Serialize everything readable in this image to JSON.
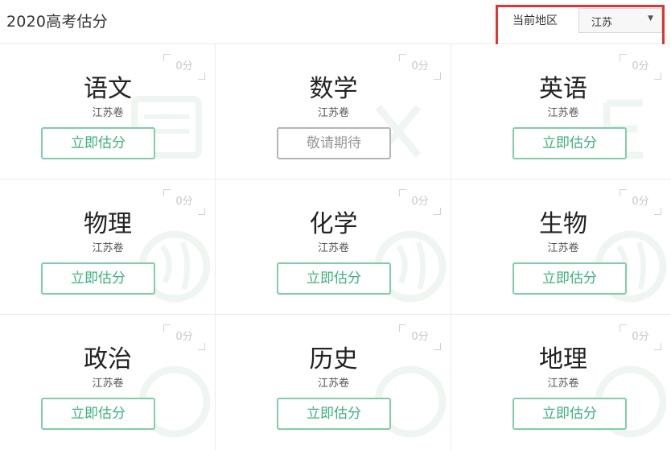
{
  "header": {
    "title": "2020高考估分",
    "region_label": "当前地区",
    "region_value": "江苏"
  },
  "subjects": [
    {
      "name": "语文",
      "paper": "江苏卷",
      "score": "0分",
      "button": "立即估分",
      "button_state": "active"
    },
    {
      "name": "数学",
      "paper": "江苏卷",
      "score": "0分",
      "button": "敬请期待",
      "button_state": "disabled"
    },
    {
      "name": "英语",
      "paper": "江苏卷",
      "score": "0分",
      "button": "立即估分",
      "button_state": "active"
    },
    {
      "name": "物理",
      "paper": "江苏卷",
      "score": "0分",
      "button": "立即估分",
      "button_state": "active"
    },
    {
      "name": "化学",
      "paper": "江苏卷",
      "score": "0分",
      "button": "立即估分",
      "button_state": "active"
    },
    {
      "name": "生物",
      "paper": "江苏卷",
      "score": "0分",
      "button": "立即估分",
      "button_state": "active"
    },
    {
      "name": "政治",
      "paper": "江苏卷",
      "score": "0分",
      "button": "立即估分",
      "button_state": "active"
    },
    {
      "name": "历史",
      "paper": "江苏卷",
      "score": "0分",
      "button": "立即估分",
      "button_state": "active"
    },
    {
      "name": "地理",
      "paper": "江苏卷",
      "score": "0分",
      "button": "立即估分",
      "button_state": "active"
    }
  ],
  "colors": {
    "accent_green": "#3db07a",
    "button_border": "#7fcfa6",
    "annotation_red": "#e8322e"
  }
}
